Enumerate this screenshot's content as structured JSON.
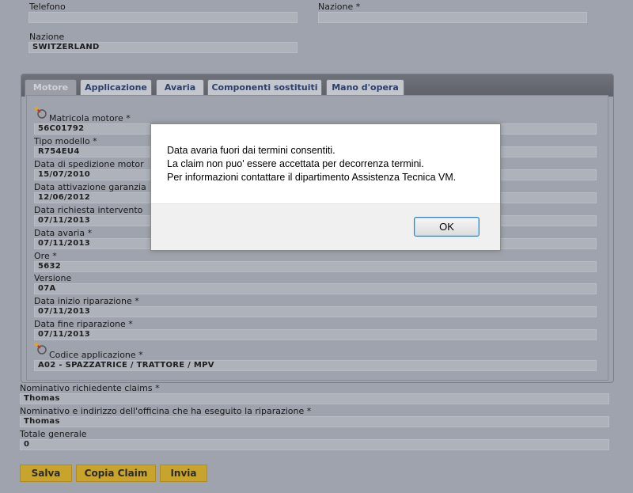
{
  "top": {
    "telefono_label": "Telefono",
    "telefono_value": "",
    "nazione_right_label": "Nazione *",
    "nazione_right_value": "",
    "nazione_label": "Nazione",
    "nazione_value": "SWITZERLAND"
  },
  "tabs": [
    {
      "label": "Motore",
      "active": true
    },
    {
      "label": "Applicazione",
      "active": false
    },
    {
      "label": "Avaria",
      "active": false
    },
    {
      "label": "Componenti sostituiti",
      "active": false
    },
    {
      "label": "Mano d'opera",
      "active": false
    }
  ],
  "motore": {
    "matricola_label": "Matricola motore *",
    "matricola_value": "56C01792",
    "tipo_label": "Tipo modello *",
    "tipo_value": "R754EU4",
    "spedizione_label": "Data di spedizione motor",
    "spedizione_value": "15/07/2010",
    "attivazione_label": "Data attivazione garanzia",
    "attivazione_value": "12/06/2012",
    "richiesta_label": "Data richiesta intervento",
    "richiesta_value": "07/11/2013",
    "avaria_label": "Data avaria *",
    "avaria_value": "07/11/2013",
    "ore_label": "Ore *",
    "ore_value": "5632",
    "versione_label": "Versione",
    "versione_value": "07A",
    "inizio_label": "Data inizio riparazione *",
    "inizio_value": "07/11/2013",
    "fine_label": "Data fine riparazione *",
    "fine_value": "07/11/2013",
    "codice_label": "Codice applicazione *",
    "codice_value": "A02 - SPAZZATRICE / TRATTORE / MPV"
  },
  "bottom": {
    "richiedente_label": "Nominativo richiedente claims *",
    "richiedente_value": "Thomas",
    "officina_label": "Nominativo e indirizzo dell'officina che ha eseguito la riparazione *",
    "officina_value": "Thomas",
    "totale_label": "Totale generale",
    "totale_value": "0"
  },
  "buttons": {
    "salva": "Salva",
    "copia": "Copia Claim",
    "invia": "Invia"
  },
  "dialog": {
    "line1": "Data avaria fuori dai termini consentiti.",
    "line2": "La claim non puo' essere accettata per decorrenza termini.",
    "line3": "Per informazioni contattare il dipartimento Assistenza Tecnica VM.",
    "ok": "OK"
  },
  "colors": {
    "background": "#9fa3ad",
    "button_gold": "#c9a42c",
    "tab_text": "#2b3f6b"
  }
}
